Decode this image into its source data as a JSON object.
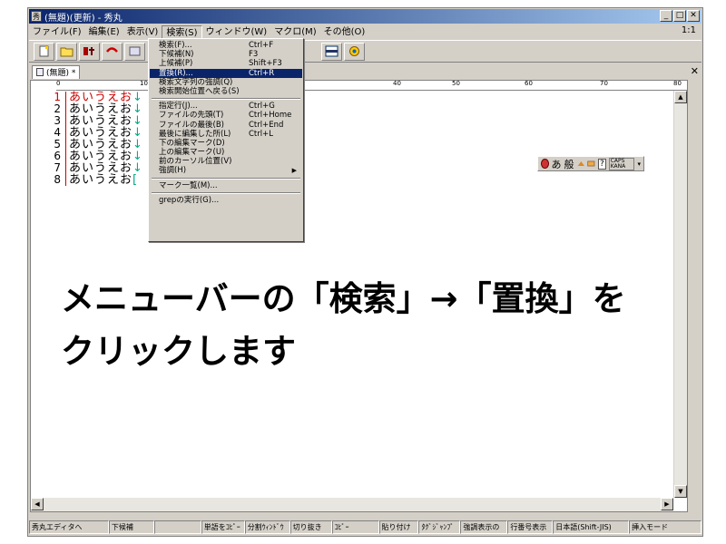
{
  "window": {
    "title": "(無題)(更新) - 秀丸",
    "app_icon": "秀"
  },
  "menubar": {
    "items": [
      "ファイル(F)",
      "編集(E)",
      "表示(V)",
      "検索(S)",
      "ウィンドウ(W)",
      "マクロ(M)",
      "その他(O)"
    ],
    "zoom": "1:1"
  },
  "tab": {
    "label": "(無題) *"
  },
  "ruler": {
    "labels": [
      "0",
      "10",
      "40",
      "50",
      "60",
      "70",
      "80"
    ]
  },
  "editor": {
    "line_numbers": [
      "1",
      "2",
      "3",
      "4",
      "5",
      "6",
      "7",
      "8"
    ],
    "lines": [
      {
        "text": "あいうえお",
        "eol": "↓"
      },
      {
        "text": "あいうえお",
        "eol": "↓"
      },
      {
        "text": "あいうえお",
        "eol": "↓"
      },
      {
        "text": "あいうえお",
        "eol": "↓"
      },
      {
        "text": "あいうえお",
        "eol": "↓"
      },
      {
        "text": "あいうえお",
        "eol": "↓"
      },
      {
        "text": "あいうえお",
        "eol": "↓"
      },
      {
        "text": "あいうえお",
        "eol": "["
      }
    ]
  },
  "search_menu": {
    "items": [
      {
        "label": "検索(F)...",
        "shortcut": "Ctrl+F"
      },
      {
        "label": "下候補(N)",
        "shortcut": "F3"
      },
      {
        "label": "上候補(P)",
        "shortcut": "Shift+F3"
      },
      {
        "label": "置換(R)...",
        "shortcut": "Ctrl+R",
        "highlighted": true
      },
      {
        "label": "検索文字列の強調(Q)",
        "shortcut": ""
      },
      {
        "label": "検索開始位置へ戻る(S)",
        "shortcut": ""
      },
      {
        "sep": true
      },
      {
        "label": "指定行(J)...",
        "shortcut": "Ctrl+G"
      },
      {
        "label": "ファイルの先頭(T)",
        "shortcut": "Ctrl+Home"
      },
      {
        "label": "ファイルの最後(B)",
        "shortcut": "Ctrl+End"
      },
      {
        "label": "最後に編集した所(L)",
        "shortcut": "Ctrl+L"
      },
      {
        "label": "下の編集マーク(D)",
        "shortcut": ""
      },
      {
        "label": "上の編集マーク(U)",
        "shortcut": ""
      },
      {
        "label": "前のカーソル位置(V)",
        "shortcut": ""
      },
      {
        "label": "強調(H)",
        "shortcut": "",
        "submenu": true
      },
      {
        "sep": true
      },
      {
        "label": "マーク一覧(M)...",
        "shortcut": ""
      },
      {
        "sep": true
      },
      {
        "label": "grepの実行(G)...",
        "shortcut": ""
      }
    ]
  },
  "ime_bar": {
    "mode_char": "あ",
    "conv_char": "般",
    "caps_label": "CAPS KANA"
  },
  "statusbar": {
    "items": [
      "秀丸エディタへ",
      "下候補",
      "",
      "単語をｺﾋﾟｰ",
      "分割ｳｨﾝﾄﾞｳ",
      "切り抜き",
      "ｺﾋﾟｰ",
      "貼り付け",
      "ﾀｸﾞｼﾞｬﾝﾌﾟ",
      "強調表示の",
      "行番号表示",
      "日本語(Shift-JIS)",
      "挿入モード"
    ]
  },
  "caption": {
    "line1": "メニューバーの「検索」→「置換」を",
    "line2": "クリックします"
  }
}
